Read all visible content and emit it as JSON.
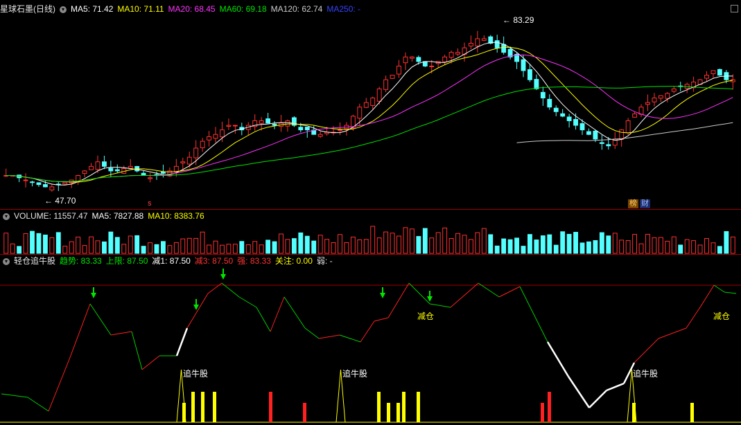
{
  "main_legend": {
    "title": "星球石墨(日线)",
    "ma5": "MA5: 71.42",
    "ma10": "MA10: 71.11",
    "ma20": "MA20: 68.45",
    "ma60": "MA60: 69.18",
    "ma120": "MA120: 62.74",
    "ma250": "MA250: -"
  },
  "annotations": {
    "high": "83.29",
    "low": "47.70",
    "tag_bang": "榜",
    "tag_cai": "财"
  },
  "volume_legend": {
    "volume": "VOLUME: 11557.47",
    "ma5": "MA5: 7827.88",
    "ma10": "MA10: 8383.76"
  },
  "indicator_legend": {
    "name": "轻仓追牛股",
    "trend": "趋势: 83.33",
    "upper": "上限: 87.50",
    "minus1": "减1: 87.50",
    "minus3": "减3: 87.50",
    "strong": "强: 83.33",
    "watch": "关注: 0.00",
    "weak": "弱: -"
  },
  "signals": {
    "chase": "追牛股",
    "reduce": "减仓"
  },
  "colors": {
    "up": "#ff3232",
    "down": "#54ffff",
    "ma5": "#ffffff",
    "ma10": "#ffff00",
    "ma20": "#ff33ff",
    "ma60": "#00e600",
    "ma120": "#cccccc",
    "ma250": "#3344ff",
    "grid": "#a00000"
  },
  "chart_data": {
    "type": "candlestick",
    "close_series": [
      51,
      51,
      50.5,
      50,
      49.5,
      49,
      48.5,
      48.5,
      49,
      49.5,
      50,
      51,
      52,
      53,
      54,
      53,
      52,
      52,
      52.5,
      53,
      52,
      51,
      50.5,
      51,
      51.5,
      52,
      53,
      54,
      55,
      57,
      58.5,
      59.5,
      60,
      61,
      62,
      62,
      61,
      62,
      63,
      63,
      62.5,
      62,
      62.5,
      63,
      62,
      61,
      61,
      60,
      60,
      60.5,
      60.5,
      61,
      62,
      64,
      66,
      67,
      68,
      70,
      72,
      73,
      75,
      77,
      77,
      76,
      75,
      75,
      76,
      77,
      78,
      78,
      79,
      80,
      81,
      81,
      80,
      79,
      78,
      77,
      76,
      74,
      72,
      70,
      68,
      66,
      65,
      64,
      63,
      62,
      61,
      60,
      59,
      58,
      57.5,
      59,
      61,
      63,
      64.5,
      66,
      67,
      68,
      68.5,
      69,
      70,
      70.5,
      71,
      71.5,
      72,
      73,
      74,
      73,
      72,
      72
    ]
  }
}
